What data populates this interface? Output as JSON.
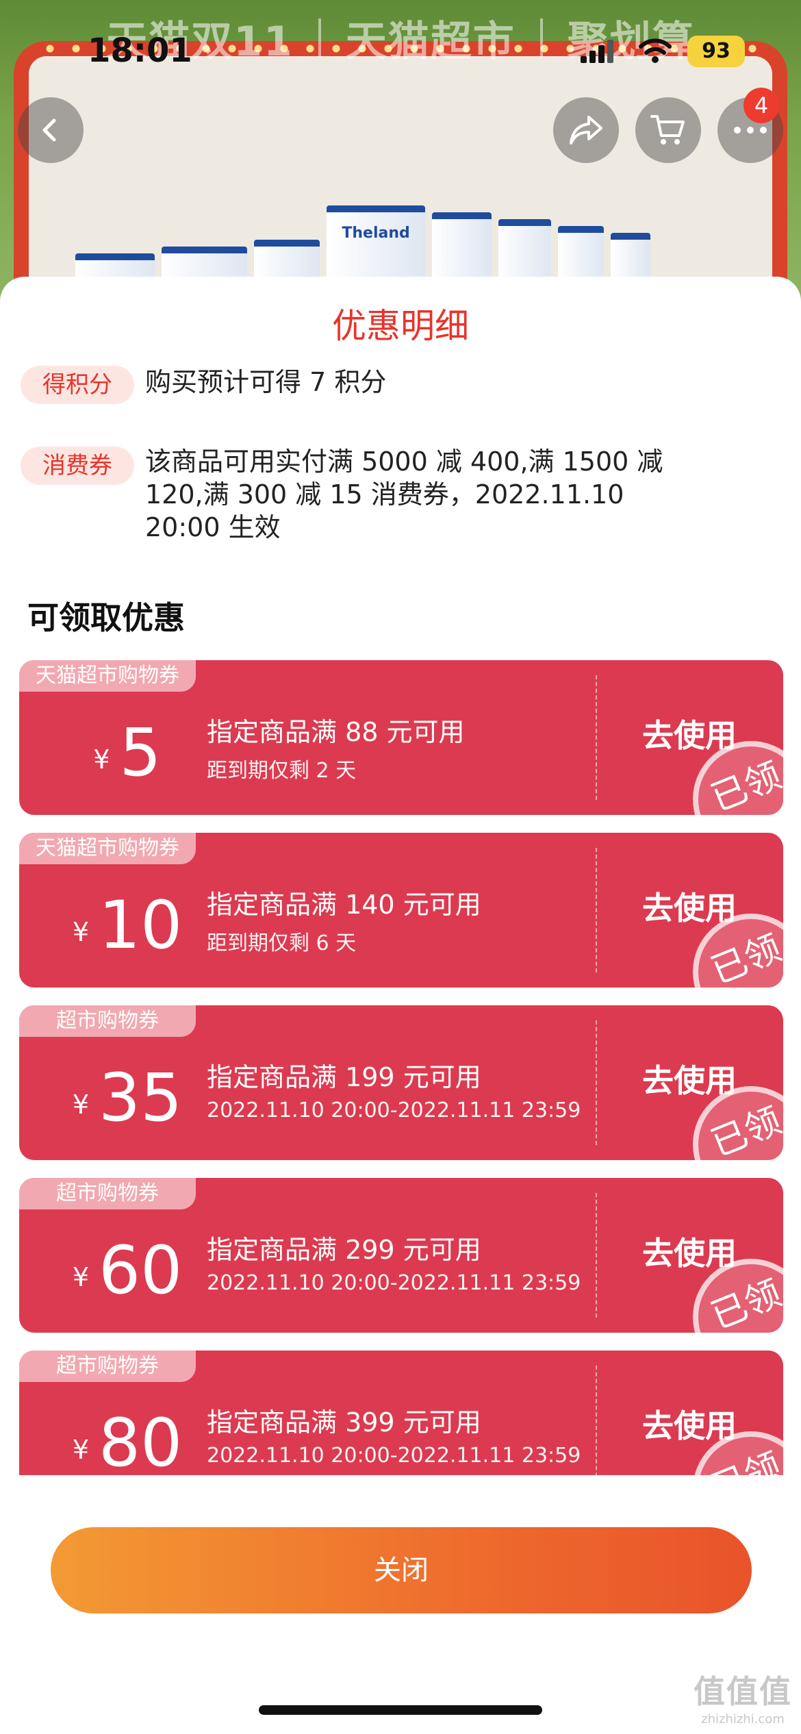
{
  "status_bar": {
    "time": "18:01",
    "battery": "93"
  },
  "header": {
    "promo": [
      "天猫双11",
      "天猫超市",
      "聚划算"
    ],
    "product_brand": "Theland",
    "cart_badge": "4"
  },
  "sheet": {
    "title": "优惠明细",
    "points": {
      "tag": "得积分",
      "text": "购买预计可得 7 积分"
    },
    "voucher": {
      "tag": "消费券",
      "lines": [
        "该商品可用实付满 5000 减 400,满 1500 减",
        "120,满 300 减 15 消费券，2022.11.10",
        "20:00 生效"
      ]
    },
    "section_title": "可领取优惠",
    "coupons": [
      {
        "tag": "天猫超市购物券",
        "currency": "¥",
        "amount": "5",
        "condition": "指定商品满 88 元可用",
        "detail": "距到期仅剩 2 天",
        "action": "去使用",
        "stamp": "已领"
      },
      {
        "tag": "天猫超市购物券",
        "currency": "¥",
        "amount": "10",
        "condition": "指定商品满 140 元可用",
        "detail": "距到期仅剩 6 天",
        "action": "去使用",
        "stamp": "已领"
      },
      {
        "tag": "超市购物券",
        "currency": "¥",
        "amount": "35",
        "condition": "指定商品满 199 元可用",
        "detail": "2022.11.10 20:00-2022.11.11 23:59",
        "action": "去使用",
        "stamp": "已领"
      },
      {
        "tag": "超市购物券",
        "currency": "¥",
        "amount": "60",
        "condition": "指定商品满 299 元可用",
        "detail": "2022.11.10 20:00-2022.11.11 23:59",
        "action": "去使用",
        "stamp": "已领"
      },
      {
        "tag": "超市购物券",
        "currency": "¥",
        "amount": "80",
        "condition": "指定商品满 399 元可用",
        "detail": "2022.11.10 20:00-2022.11.11 23:59",
        "action": "去使用",
        "stamp": "已领"
      }
    ],
    "close_label": "关闭"
  },
  "watermark": {
    "mark": "值值值",
    "domain": "zhizhizhi.com"
  },
  "colors": {
    "accent": "#e8332b",
    "coupon": "#dc3a50",
    "close_start": "#f39a34",
    "close_end": "#e9532b"
  }
}
